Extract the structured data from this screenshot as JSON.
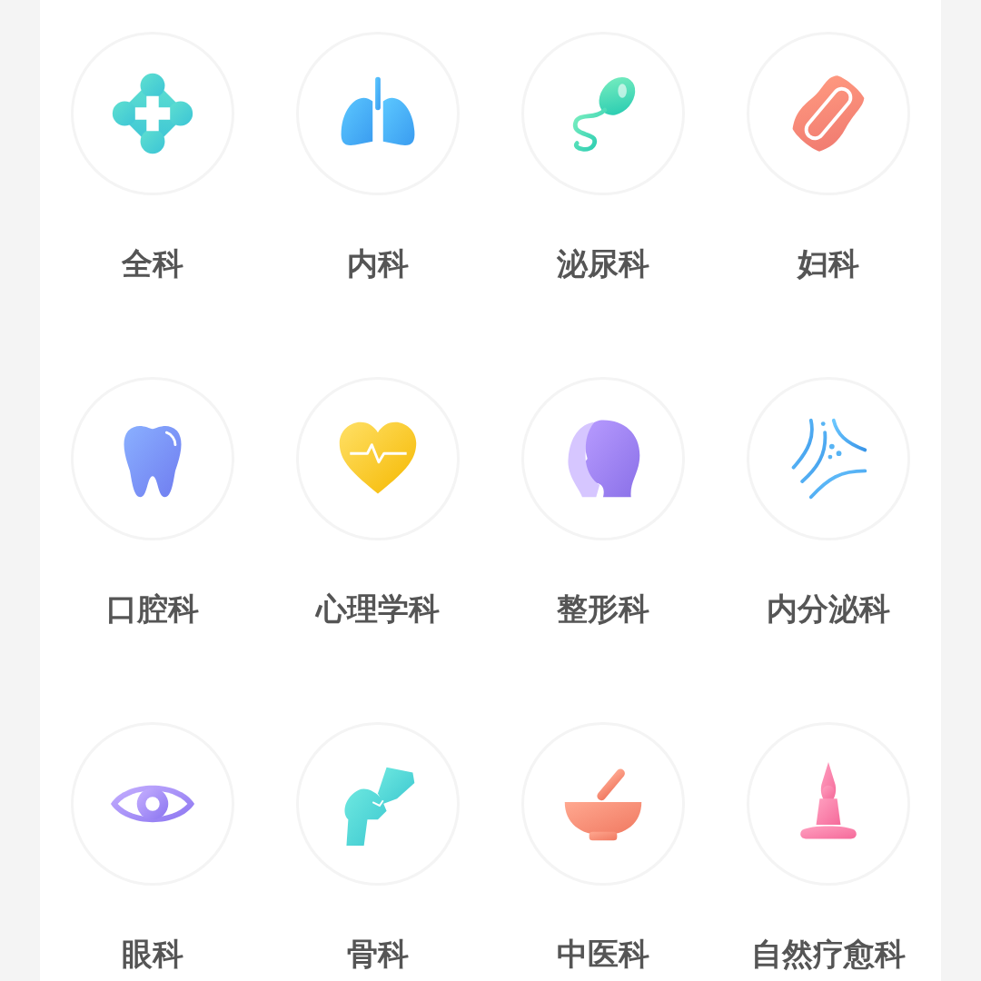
{
  "departments": [
    {
      "label": "全科"
    },
    {
      "label": "内科"
    },
    {
      "label": "泌尿科"
    },
    {
      "label": "妇科"
    },
    {
      "label": "口腔科"
    },
    {
      "label": "心理学科"
    },
    {
      "label": "整形科"
    },
    {
      "label": "内分泌科"
    },
    {
      "label": "眼科"
    },
    {
      "label": "骨科"
    },
    {
      "label": "中医科"
    },
    {
      "label": "自然疗愈科"
    }
  ]
}
